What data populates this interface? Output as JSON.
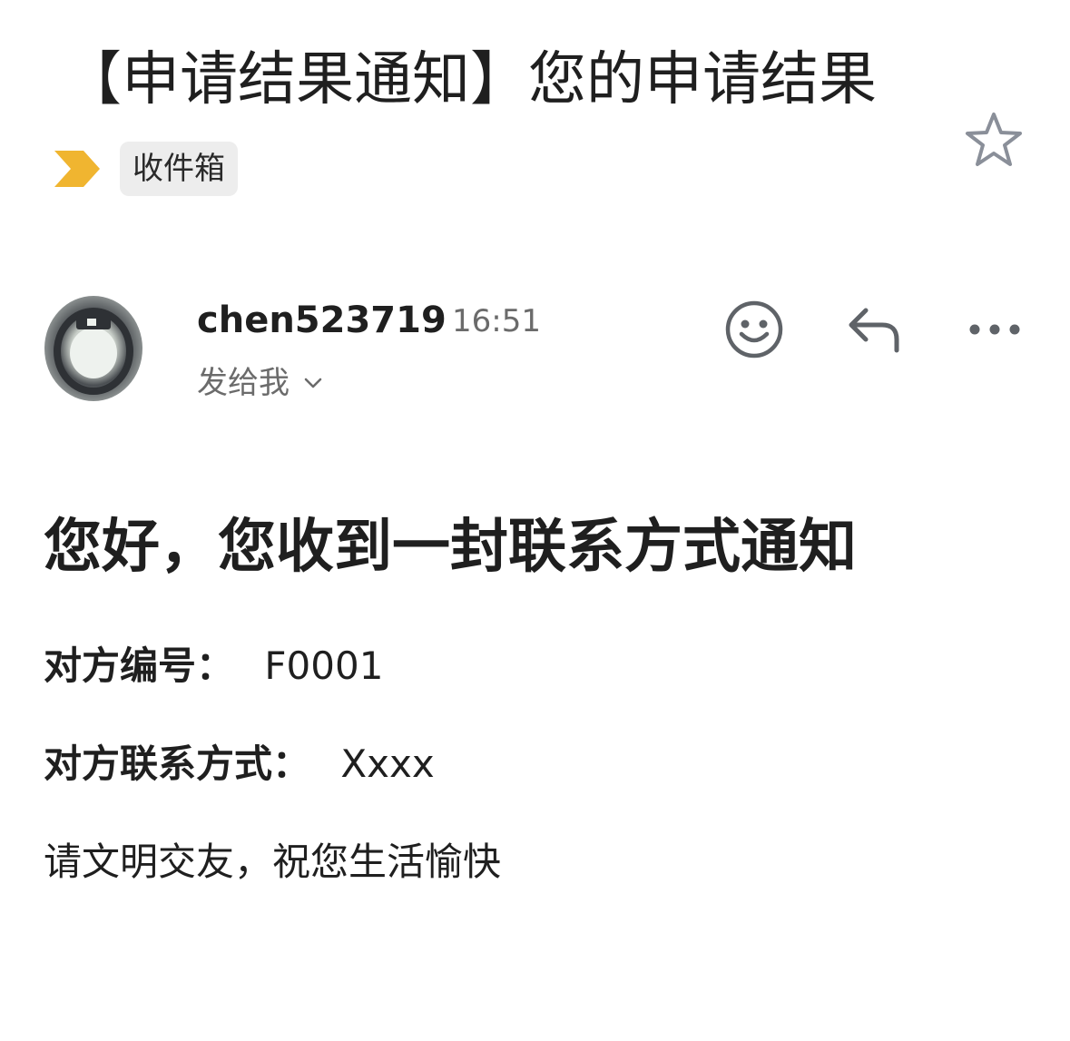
{
  "email": {
    "subject": "【申请结果通知】您的申请结果",
    "folder_label": "收件箱",
    "sender_name": "chen523719",
    "time": "16:51",
    "recipient_label": "发给我",
    "body": {
      "greeting": "您好，您收到一封联系方式通知",
      "partner_id_label": "对方编号：",
      "partner_id_value": "F0001",
      "contact_label": "对方联系方式：",
      "contact_value": "Xxxx",
      "closing": "请文明交友，祝您生活愉快"
    }
  },
  "icons": {
    "importance": "importance-marker-icon",
    "star": "star-icon",
    "emoji": "emoji-reaction-icon",
    "reply": "reply-icon",
    "more": "more-options-icon",
    "chevron": "chevron-down-icon"
  },
  "colors": {
    "importance_marker": "#f0b530",
    "star_outline": "#8a8f99",
    "icon_gray": "#5f6368",
    "chip_background": "#ededed",
    "secondary_text": "#6b6b6b"
  }
}
